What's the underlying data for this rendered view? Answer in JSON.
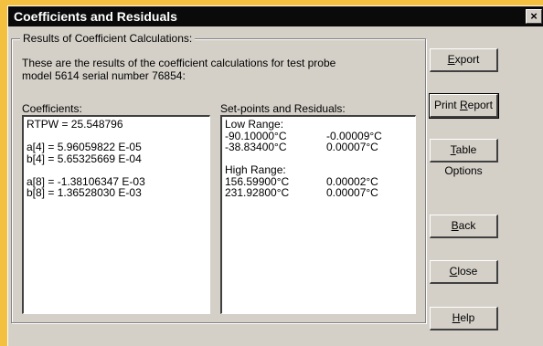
{
  "window": {
    "title": "Coefficients and Residuals",
    "close_label": "×"
  },
  "group": {
    "legend": "Results of Coefficient Calculations:",
    "intro_line1": "These are the results of the coefficient calculations for test probe",
    "intro_line2": "model 5614 serial number 76854:"
  },
  "coefficients": {
    "label": "Coefficients:",
    "rtpw": "RTPW = 25.548796",
    "a4": "a[4] = 5.96059822 E-05",
    "b4": "b[4] = 5.65325669 E-04",
    "a8": "a[8] = -1.38106347 E-03",
    "b8": "b[8] = 1.36528030 E-03"
  },
  "residuals": {
    "label": "Set-points and Residuals:",
    "low_range_label": "Low Range:",
    "low": [
      {
        "setpoint": "-90.10000°C",
        "residual": "-0.00009°C"
      },
      {
        "setpoint": "-38.83400°C",
        "residual": "0.00007°C"
      }
    ],
    "high_range_label": "High Range:",
    "high": [
      {
        "setpoint": "156.59900°C",
        "residual": "0.00002°C"
      },
      {
        "setpoint": "231.92800°C",
        "residual": "0.00007°C"
      }
    ]
  },
  "buttons": {
    "export": {
      "key": "E",
      "rest": "xport"
    },
    "print": {
      "pre": "Print ",
      "key": "R",
      "rest": "eport"
    },
    "table_options": {
      "key": "T",
      "rest": "able Options"
    },
    "back": {
      "key": "B",
      "rest": "ack"
    },
    "close": {
      "key": "C",
      "rest": "lose"
    },
    "help": {
      "key": "H",
      "rest": "elp"
    }
  }
}
